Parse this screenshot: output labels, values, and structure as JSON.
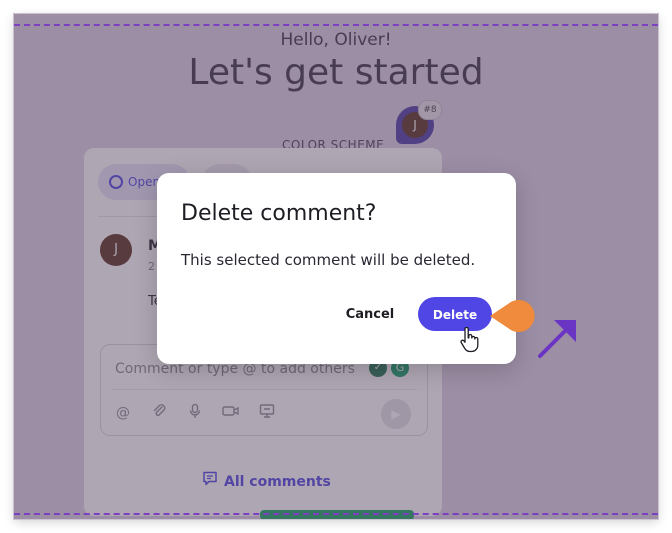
{
  "page": {
    "greeting": "Hello, Oliver!",
    "title": "Let's get started",
    "color_scheme_label": "COLOR SCHEME"
  },
  "avatar_pin": {
    "initial": "J",
    "count": "#8"
  },
  "comment_panel": {
    "filter_open_label": "Open",
    "comment": {
      "avatar_initial": "J",
      "author": "M",
      "time": "2",
      "text": "Te"
    },
    "composer": {
      "placeholder": "Comment or type @ to add others",
      "tools": [
        "at-icon",
        "paperclip-icon",
        "microphone-icon",
        "video-icon",
        "screen-icon"
      ]
    },
    "all_comments_label": "All comments"
  },
  "dialog": {
    "title": "Delete comment?",
    "message": "This selected comment will be deleted.",
    "cancel_label": "Cancel",
    "delete_label": "Delete"
  },
  "colors": {
    "accent": "#4f46e5",
    "annotation_orange": "#f08a3c",
    "annotation_purple": "#6a34c4"
  }
}
